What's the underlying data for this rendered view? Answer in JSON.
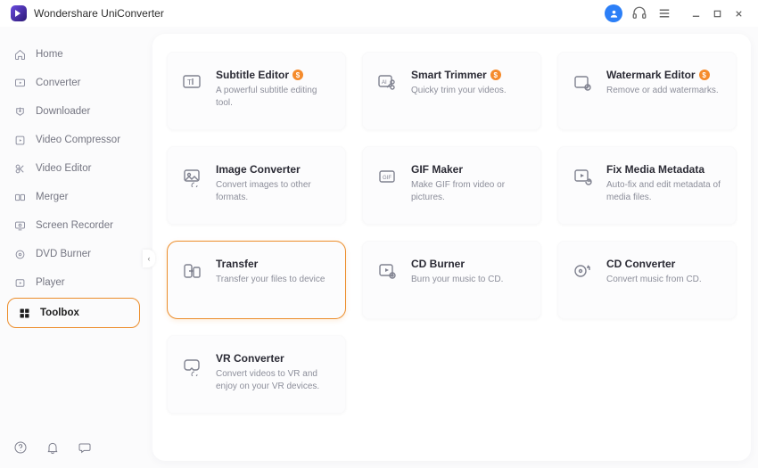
{
  "app": {
    "title": "Wondershare UniConverter"
  },
  "collapse_glyph": "‹",
  "sidebar": {
    "items": [
      {
        "id": "home",
        "label": "Home"
      },
      {
        "id": "converter",
        "label": "Converter"
      },
      {
        "id": "downloader",
        "label": "Downloader"
      },
      {
        "id": "video-compressor",
        "label": "Video Compressor"
      },
      {
        "id": "video-editor",
        "label": "Video Editor"
      },
      {
        "id": "merger",
        "label": "Merger"
      },
      {
        "id": "screen-recorder",
        "label": "Screen Recorder"
      },
      {
        "id": "dvd-burner",
        "label": "DVD Burner"
      },
      {
        "id": "player",
        "label": "Player"
      },
      {
        "id": "toolbox",
        "label": "Toolbox"
      }
    ]
  },
  "title_icons": {
    "user": "user-icon",
    "headset": "headset-icon",
    "menu": "hamburger-icon",
    "min": "minimize",
    "max": "maximize",
    "close": "close"
  },
  "paid_symbol": "$",
  "tools": [
    {
      "title": "Subtitle Editor",
      "desc": "A powerful subtitle editing tool.",
      "paid": true
    },
    {
      "title": "Smart Trimmer",
      "desc": "Quicky trim your videos.",
      "paid": true
    },
    {
      "title": "Watermark Editor",
      "desc": "Remove or add watermarks.",
      "paid": true
    },
    {
      "title": "Image Converter",
      "desc": "Convert images to other formats.",
      "paid": false
    },
    {
      "title": "GIF Maker",
      "desc": "Make GIF from video or pictures.",
      "paid": false
    },
    {
      "title": "Fix Media Metadata",
      "desc": "Auto-fix and edit metadata of media files.",
      "paid": false
    },
    {
      "title": "Transfer",
      "desc": "Transfer your files to device",
      "paid": false
    },
    {
      "title": "CD Burner",
      "desc": "Burn your music to CD.",
      "paid": false
    },
    {
      "title": "CD Converter",
      "desc": "Convert music from CD.",
      "paid": false
    },
    {
      "title": "VR Converter",
      "desc": "Convert videos to VR and enjoy on your VR devices.",
      "paid": false
    }
  ]
}
